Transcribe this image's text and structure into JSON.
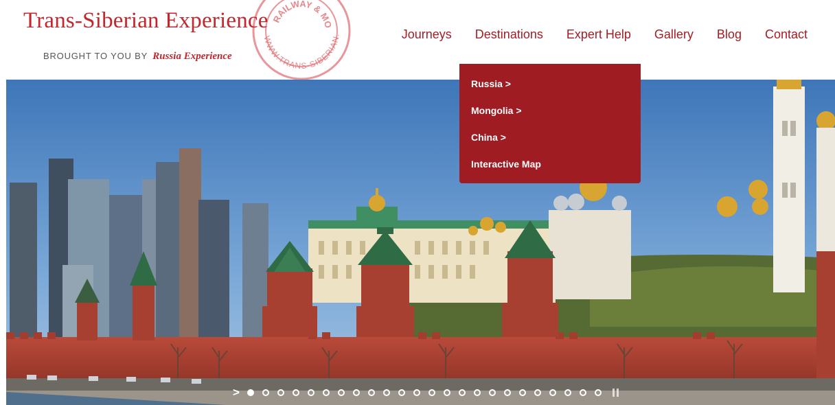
{
  "brand": {
    "title": "Trans-Siberian Experience",
    "subtitle": "BROUGHT TO YOU BY",
    "subtitle_script": "Russia Experience",
    "stamp_text": "WWW.TRANS-SIBERIAN.CO.UK",
    "stamp_inner": "RAILWAY & MORE",
    "brand_color": "#c1272d"
  },
  "nav": {
    "items": [
      {
        "label": "Journeys"
      },
      {
        "label": "Destinations"
      },
      {
        "label": "Expert Help"
      },
      {
        "label": "Gallery"
      },
      {
        "label": "Blog"
      },
      {
        "label": "Contact"
      }
    ]
  },
  "dropdown": {
    "items": [
      {
        "label": "Russia >"
      },
      {
        "label": "Mongolia >"
      },
      {
        "label": "China >"
      },
      {
        "label": "Interactive Map"
      }
    ],
    "color": "#9e1c22"
  },
  "slider": {
    "arrow": ">",
    "dot_count": 24,
    "active_index": 0
  }
}
